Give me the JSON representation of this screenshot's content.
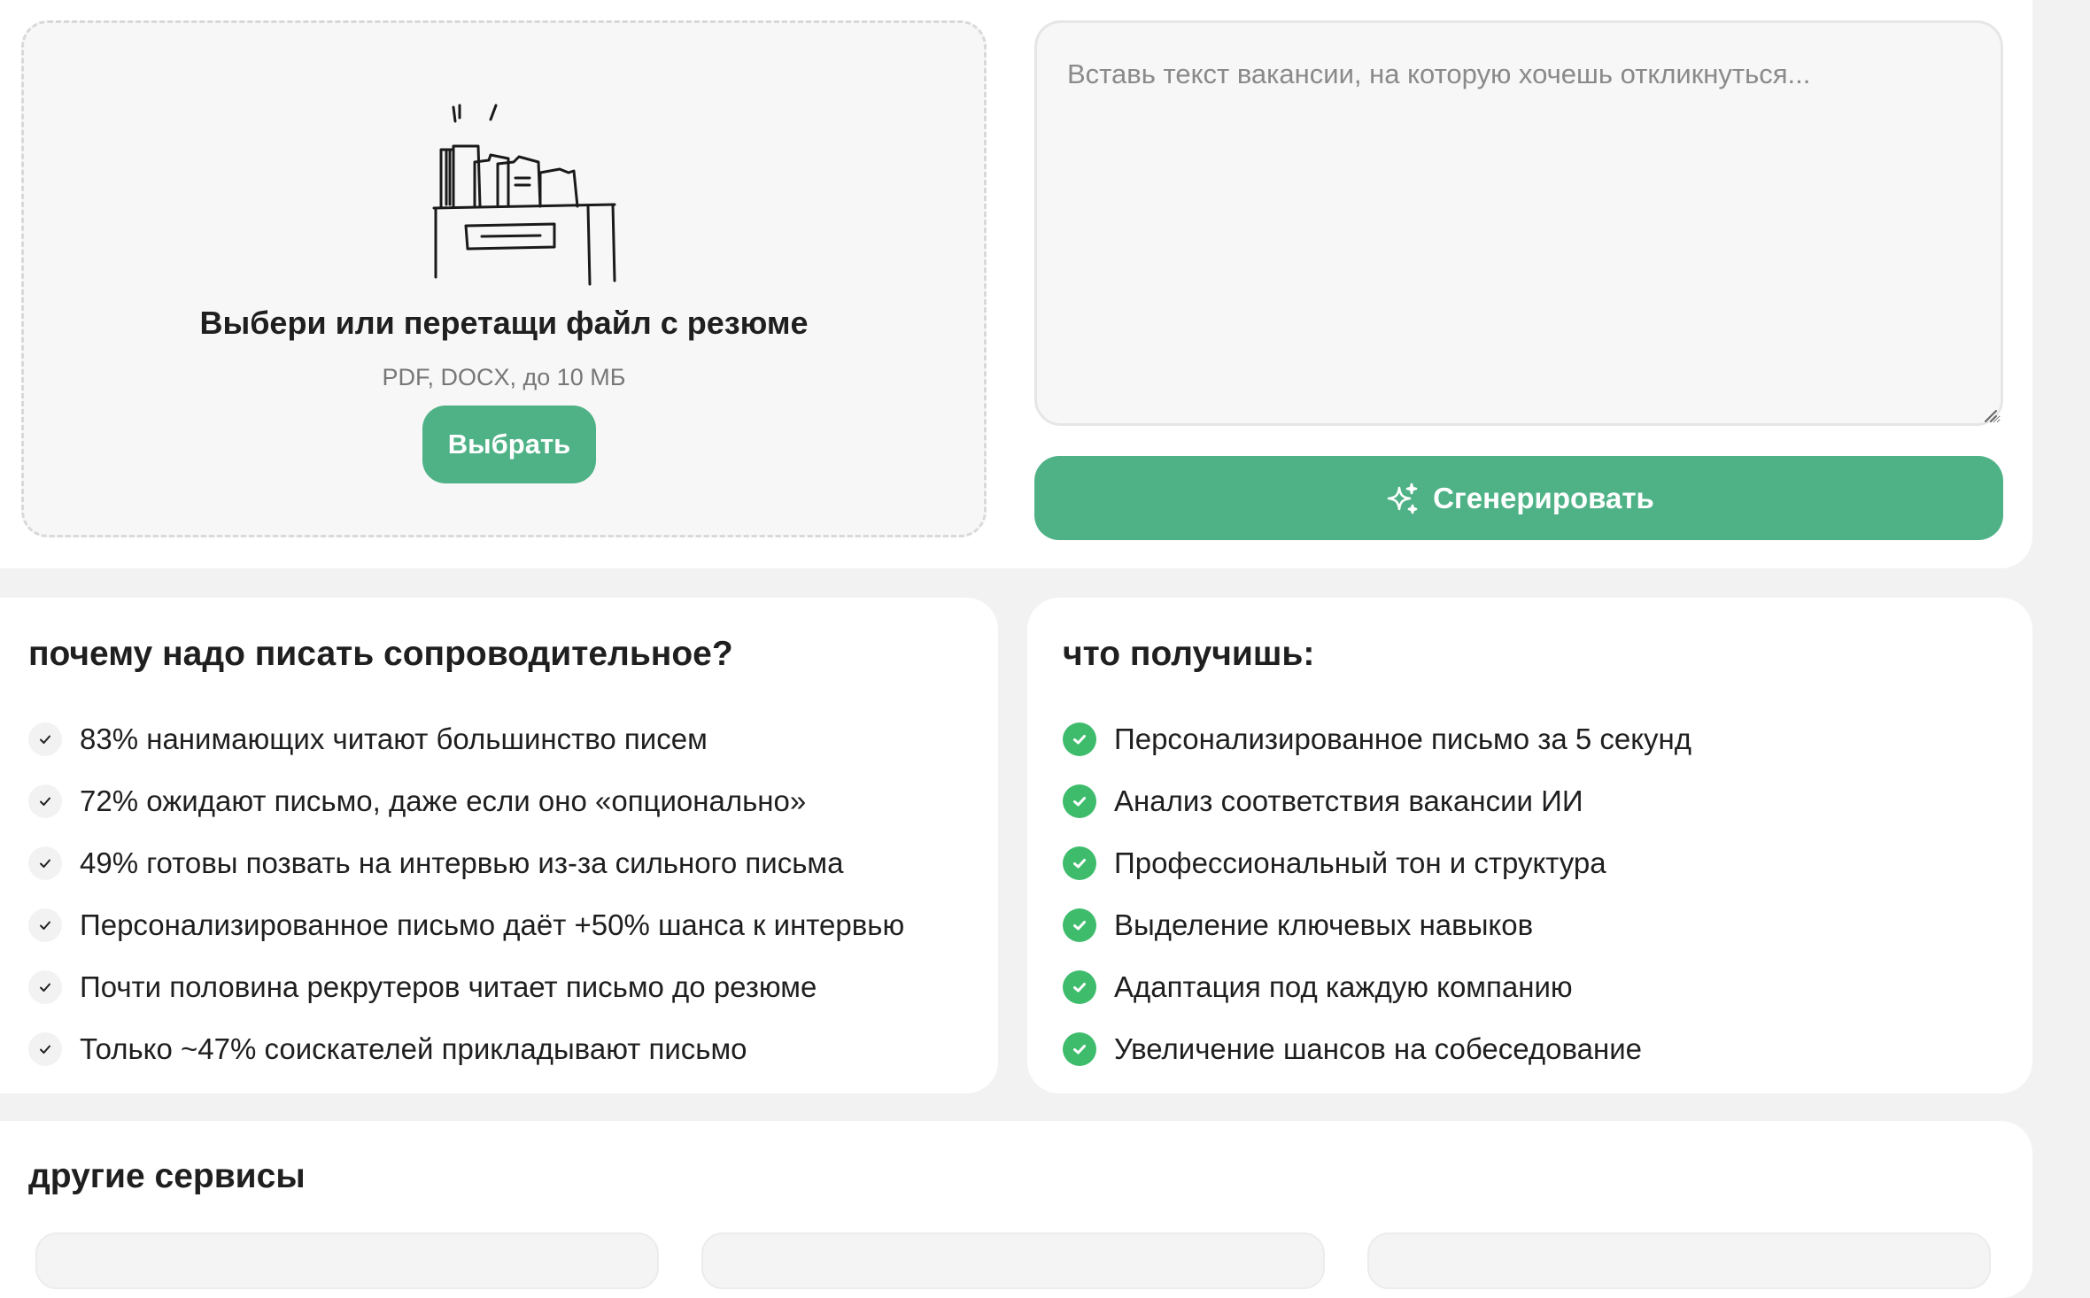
{
  "upload": {
    "title": "Выбери или перетащи файл с резюме",
    "hint": "PDF, DOCX, до 10 МБ",
    "button_label": "Выбрать",
    "illustration_icon": "desk-with-documents-illustration"
  },
  "vacancy": {
    "placeholder": "Вставь текст вакансии, на которую хочешь откликнуться...",
    "value": ""
  },
  "generate": {
    "label": "Сгенерировать",
    "icon": "sparkles-icon"
  },
  "why": {
    "title": "почему надо писать сопроводительное?",
    "items": [
      "83% нанимающих читают большинство писем",
      "72% ожидают письмо, даже если оно «опционально»",
      "49% готовы позвать на интервью из-за сильного письма",
      "Персонализированное письмо даёт +50% шанса к интервью",
      "Почти половина рекрутеров читает письмо до резюме",
      "Только ~47% соискателей прикладывают письмо"
    ]
  },
  "benefits": {
    "title": "что получишь:",
    "items": [
      "Персонализированное письмо за 5 секунд",
      "Анализ соответствия вакансии ИИ",
      "Профессиональный тон и структура",
      "Выделение ключевых навыков",
      "Адаптация под каждую компанию",
      "Увеличение шансов на собеседование"
    ]
  },
  "other_services": {
    "title": "другие сервисы"
  },
  "colors": {
    "accent": "#4fb286",
    "check_green": "#3ebc6c",
    "page_bg": "#f2f2f2",
    "card_bg": "#ffffff"
  }
}
